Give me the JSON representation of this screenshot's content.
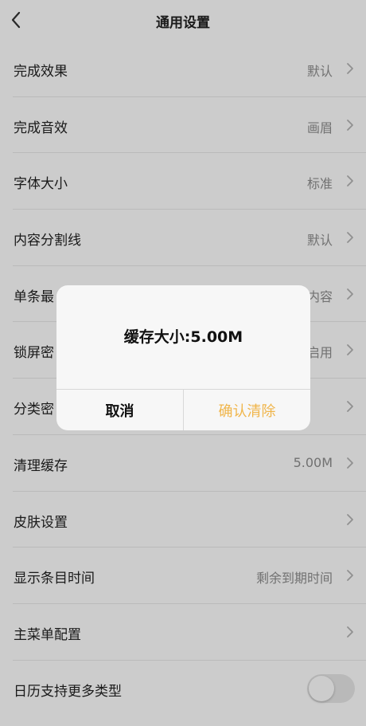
{
  "header": {
    "title": "通用设置"
  },
  "rows": [
    {
      "label": "完成效果",
      "value": "默认"
    },
    {
      "label": "完成音效",
      "value": "画眉"
    },
    {
      "label": "字体大小",
      "value": "标准"
    },
    {
      "label": "内容分割线",
      "value": "默认"
    },
    {
      "label": "单条最",
      "value": "内容"
    },
    {
      "label": "锁屏密",
      "value": "启用"
    },
    {
      "label": "分类密",
      "value": ""
    },
    {
      "label": "清理缓存",
      "value": "5.00M"
    },
    {
      "label": "皮肤设置",
      "value": ""
    },
    {
      "label": "显示条目时间",
      "value": "剩余到期时间"
    },
    {
      "label": "主菜单配置",
      "value": ""
    },
    {
      "label": "日历支持更多类型",
      "toggle_on": false
    }
  ],
  "dialog": {
    "message": "缓存大小:5.00M",
    "cancel_label": "取消",
    "confirm_label": "确认清除"
  },
  "colors": {
    "accent": "#f0b54a",
    "overlay": "rgba(0,0,0,0.2)"
  }
}
